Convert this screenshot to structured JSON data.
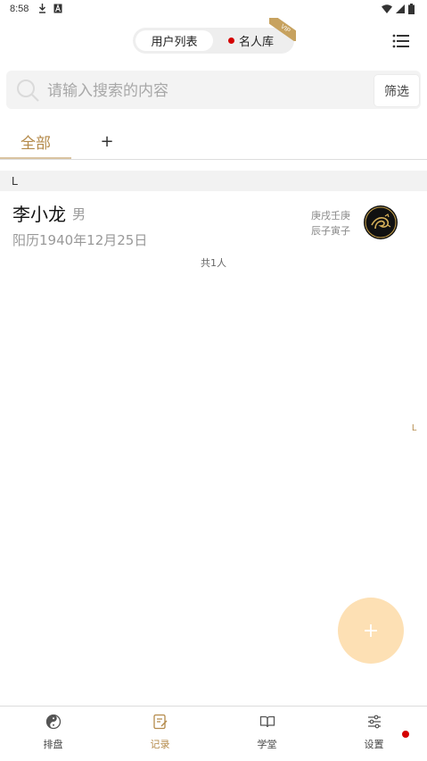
{
  "status_bar": {
    "time": "8:58"
  },
  "header": {
    "segment_left_label": "用户列表",
    "segment_right_label": "名人库",
    "vip_badge": "VIP"
  },
  "search": {
    "placeholder": "请输入搜索的内容",
    "filter_label": "筛选"
  },
  "tabs": {
    "all_label": "全部",
    "add_label": "+"
  },
  "section": {
    "letter": "L"
  },
  "contact": {
    "name": "李小龙",
    "gender": "男",
    "birthdate": "阳历1940年12月25日",
    "bazi_line1": "庚戌壬庚",
    "bazi_line2": "辰子寅子"
  },
  "total": "共1人",
  "index_sidebar_letter": "L",
  "fab_label": "+",
  "bottom_nav": {
    "items": [
      {
        "label": "排盘"
      },
      {
        "label": "记录"
      },
      {
        "label": "学堂"
      },
      {
        "label": "设置"
      }
    ],
    "active_index": 1
  },
  "colors": {
    "accent": "#b48a4a",
    "fab": "#fde0b4",
    "notification": "#d40000"
  }
}
